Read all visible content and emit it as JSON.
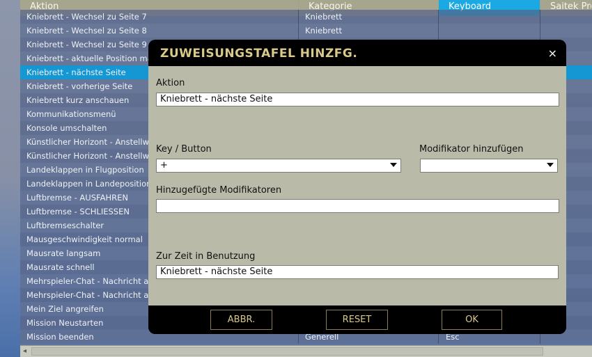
{
  "table": {
    "headers": [
      "Aktion",
      "Kategorie",
      "Keyboard",
      "Saitek Pro"
    ],
    "rows": [
      {
        "aktion": "Kniebrett - Wechsel zu Seite 7",
        "kategorie": "Kniebrett",
        "keyboard": "",
        "saitek": ""
      },
      {
        "aktion": "Kniebrett - Wechsel zu Seite 8",
        "kategorie": "Kniebrett",
        "keyboard": "",
        "saitek": ""
      },
      {
        "aktion": "Kniebrett - Wechsel zu Seite 9",
        "kategorie": "",
        "keyboard": "",
        "saitek": ""
      },
      {
        "aktion": "Kniebrett - aktuelle Position mar",
        "kategorie": "",
        "keyboard": "",
        "saitek": ""
      },
      {
        "aktion": "Kniebrett - nächste Seite",
        "kategorie": "",
        "keyboard": "",
        "saitek": "",
        "selected": true
      },
      {
        "aktion": "Kniebrett - vorherige Seite",
        "kategorie": "",
        "keyboard": "",
        "saitek": ""
      },
      {
        "aktion": "Kniebrett kurz anschauen",
        "kategorie": "",
        "keyboard": "",
        "saitek": ""
      },
      {
        "aktion": "Kommunikationsmenü",
        "kategorie": "",
        "keyboard": "",
        "saitek": ""
      },
      {
        "aktion": "Konsole umschalten",
        "kategorie": "",
        "keyboard": "",
        "saitek": ""
      },
      {
        "aktion": "Künstlicher Horizont - Anstellwin",
        "kategorie": "",
        "keyboard": "",
        "saitek": ""
      },
      {
        "aktion": "Künstlicher Horizont - Anstellwin",
        "kategorie": "",
        "keyboard": "",
        "saitek": ""
      },
      {
        "aktion": "Landeklappen in Flugposition",
        "kategorie": "",
        "keyboard": "",
        "saitek": ""
      },
      {
        "aktion": "Landeklappen in Landeposition",
        "kategorie": "",
        "keyboard": "",
        "saitek": ""
      },
      {
        "aktion": "Luftbremse - AUSFAHREN",
        "kategorie": "",
        "keyboard": "",
        "saitek": ""
      },
      {
        "aktion": "Luftbremse - SCHLIESSEN",
        "kategorie": "",
        "keyboard": "",
        "saitek": ""
      },
      {
        "aktion": "Luftbremseschalter",
        "kategorie": "",
        "keyboard": "",
        "saitek": ""
      },
      {
        "aktion": "Mausgeschwindigkeit normal",
        "kategorie": "",
        "keyboard": "",
        "saitek": ""
      },
      {
        "aktion": "Mausrate langsam",
        "kategorie": "",
        "keyboard": "",
        "saitek": ""
      },
      {
        "aktion": "Mausrate schnell",
        "kategorie": "",
        "keyboard": "",
        "saitek": ""
      },
      {
        "aktion": "Mehrspieler-Chat - Nachricht an",
        "kategorie": "",
        "keyboard": "",
        "saitek": ""
      },
      {
        "aktion": "Mehrspieler-Chat - Nachricht an",
        "kategorie": "",
        "keyboard": "",
        "saitek": ""
      },
      {
        "aktion": "Mein Ziel angreifen",
        "kategorie": "",
        "keyboard": "",
        "saitek": ""
      },
      {
        "aktion": "Mission Neustarten",
        "kategorie": "",
        "keyboard": "",
        "saitek": ""
      },
      {
        "aktion": "Mission beenden",
        "kategorie": "Generell",
        "keyboard": "Esc",
        "saitek": ""
      }
    ]
  },
  "dialog": {
    "title": "ZUWEISUNGSTAFEL HINZFG.",
    "close_icon": "×",
    "aktion_label": "Aktion",
    "aktion_value": "Kniebrett - nächste Seite",
    "key_label": "Key / Button",
    "key_value": "+",
    "modifier_label": "Modifikator hinzufügen",
    "modifier_value": "",
    "added_modifiers_label": "Hinzugefügte Modifikatoren",
    "added_modifiers_value": "",
    "in_use_label": "Zur Zeit in Benutzung",
    "in_use_value": "Kniebrett - nächste Seite",
    "buttons": {
      "cancel": "ABBR.",
      "reset": "RESET",
      "ok": "OK"
    }
  },
  "scrollbar": {
    "left_arrow": "◂"
  }
}
